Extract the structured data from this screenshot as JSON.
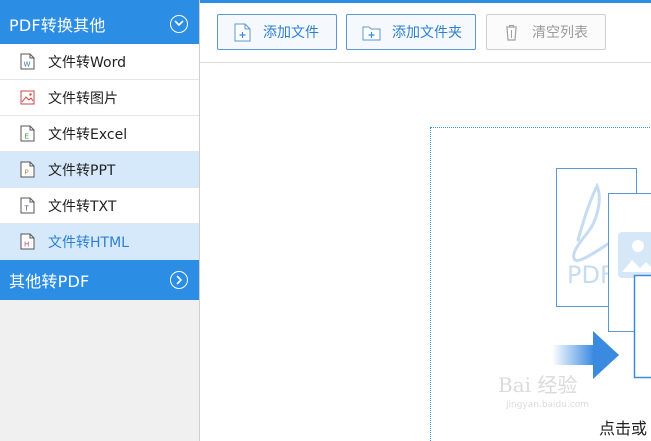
{
  "sidebar": {
    "group1": {
      "title": "PDF转换其他",
      "toggle_icon": "chevron-down-circle-icon"
    },
    "items": [
      {
        "label": "文件转Word",
        "icon": "word-doc-icon",
        "color": "#3a6fb5"
      },
      {
        "label": "文件转图片",
        "icon": "image-doc-icon",
        "color": "#d9534f"
      },
      {
        "label": "文件转Excel",
        "icon": "excel-doc-icon",
        "color": "#3c9a4a"
      },
      {
        "label": "文件转PPT",
        "icon": "ppt-doc-icon",
        "color": "#b8863b"
      },
      {
        "label": "文件转TXT",
        "icon": "txt-doc-icon",
        "color": "#3a5f8f"
      },
      {
        "label": "文件转HTML",
        "icon": "html-doc-icon",
        "color": "#b04a78"
      }
    ],
    "group2": {
      "title": "其他转PDF",
      "toggle_icon": "chevron-right-circle-icon"
    }
  },
  "toolbar": {
    "add_file_label": "添加文件",
    "add_folder_label": "添加文件夹",
    "clear_list_label": "清空列表"
  },
  "drop_area": {
    "hint_text": "点击或",
    "pdf_label": "PDF"
  },
  "watermark": {
    "line1": "Bai 经验",
    "line2": "jingyan.baidu.com"
  },
  "colors": {
    "accent": "#2b8de4",
    "selected_bg": "#d6e9fb",
    "link_text": "#2d7fd0"
  }
}
